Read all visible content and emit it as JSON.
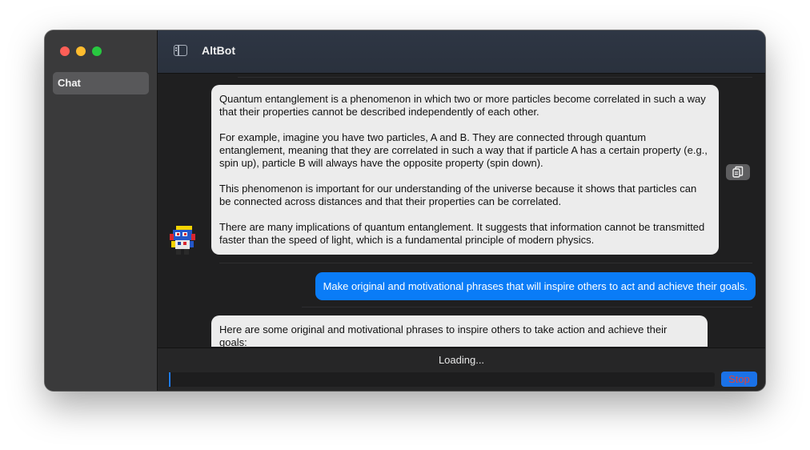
{
  "window": {
    "title": "AltBot"
  },
  "sidebar": {
    "items": [
      {
        "label": "Chat",
        "selected": true
      }
    ]
  },
  "messages": [
    {
      "role": "assistant",
      "paragraphs": [
        "Quantum entanglement is a phenomenon in which two or more particles become correlated in such a way that their properties cannot be described independently of each other.",
        "For example, imagine you have two particles, A and B. They are connected through quantum entanglement, meaning that they are correlated in such a way that if particle A has a certain property (e.g., spin up), particle B will always have the opposite property (spin down).",
        "This phenomenon is important for our understanding of the universe because it shows that particles can be connected across distances and that their properties can be correlated.",
        "There are many implications of quantum entanglement. It suggests that information cannot be transmitted faster than the speed of light, which is a fundamental principle of modern physics."
      ]
    },
    {
      "role": "user",
      "text": "Make original and motivational phrases that will inspire others to act and achieve their goals."
    },
    {
      "role": "assistant",
      "paragraphs": [
        "Here are some original and motivational phrases to inspire others to take action and achieve their goals:"
      ]
    }
  ],
  "footer": {
    "status": "Loading...",
    "input_value": "",
    "stop_label": "Stop"
  },
  "colors": {
    "accent": "#0a7cf7",
    "stop_text": "#e0433a",
    "bot_bubble": "#ececec"
  },
  "icons": [
    "sidebar-toggle-icon",
    "copy-icon",
    "robot-avatar-icon"
  ]
}
